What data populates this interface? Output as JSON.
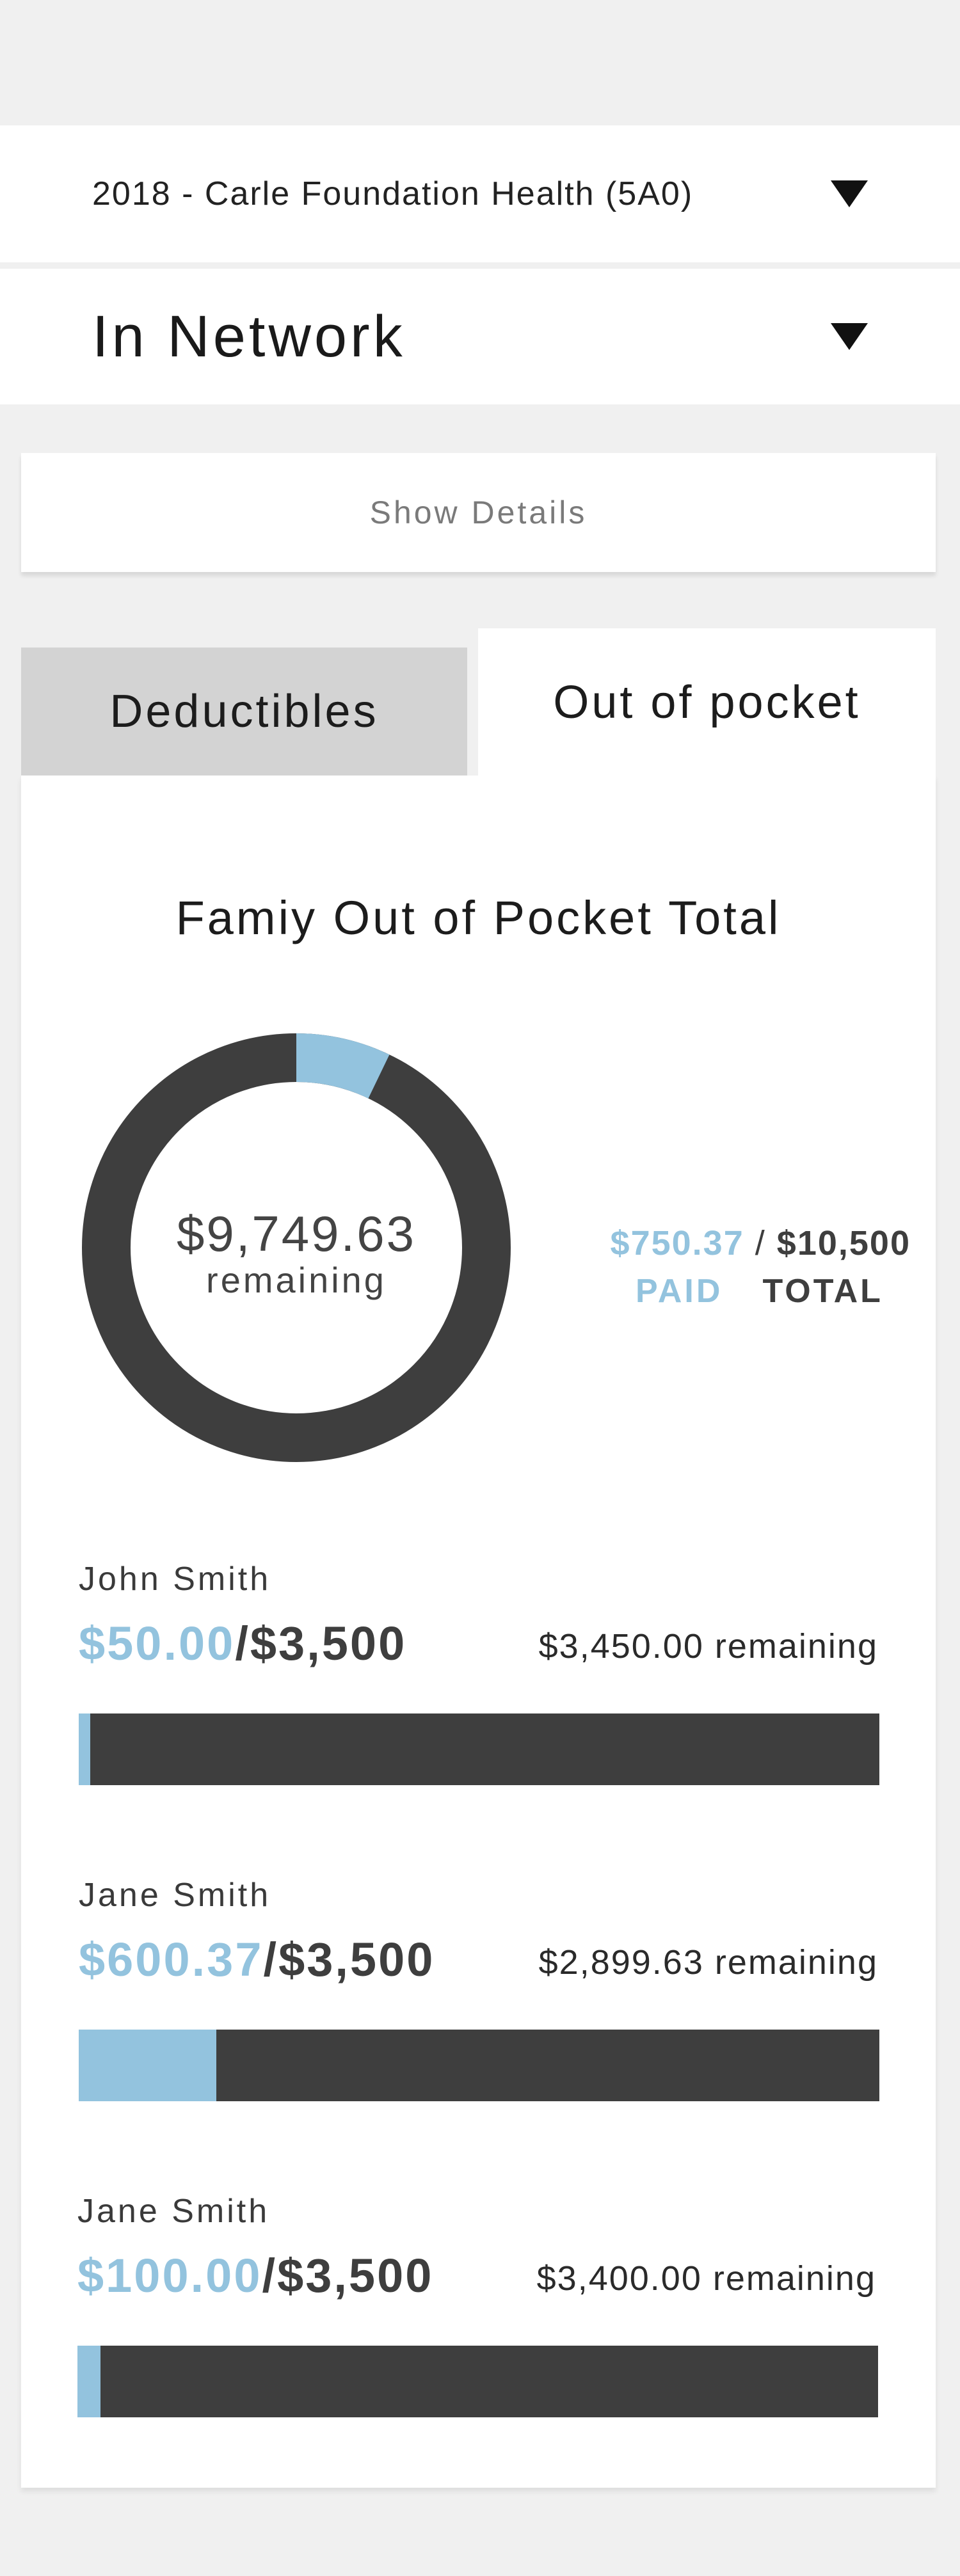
{
  "plan_select": {
    "value": "2018 - Carle Foundation Health (5A0)",
    "caret_icon": "caret-down-icon"
  },
  "network_select": {
    "value": "In Network",
    "caret_icon": "caret-down-icon"
  },
  "show_details": {
    "label": "Show Details"
  },
  "tabs": [
    {
      "label": "Deductibles",
      "active": false
    },
    {
      "label": "Out of pocket",
      "active": true
    }
  ],
  "card": {
    "title": "Famiy Out of Pocket Total",
    "donut": {
      "remaining_amount": "$9,749.63",
      "remaining_label": "remaining",
      "paid_fraction": 0.0715,
      "paid_color": "#93c3de",
      "remaining_color": "#3e3e3e"
    },
    "summary": {
      "paid": "$750.37",
      "separator": "/",
      "total": "$10,500",
      "paid_label": "PAID",
      "total_label": "TOTAL"
    },
    "members": [
      {
        "name": "John Smith",
        "paid": "$50.00",
        "separator": "/",
        "limit": "$3,500",
        "remaining": "$3,450.00 remaining",
        "progress": 0.0143
      },
      {
        "name": "Jane Smith",
        "paid": "$600.37",
        "separator": "/",
        "limit": "$3,500",
        "remaining": "$2,899.63 remaining",
        "progress": 0.1715
      },
      {
        "name": "Jane Smith",
        "paid": "$100.00",
        "separator": "/",
        "limit": "$3,500",
        "remaining": "$3,400.00 remaining",
        "progress": 0.0286
      }
    ]
  },
  "colors": {
    "accent": "#93c3de",
    "dark": "#3e3e3e",
    "background": "#f0f0f0"
  }
}
